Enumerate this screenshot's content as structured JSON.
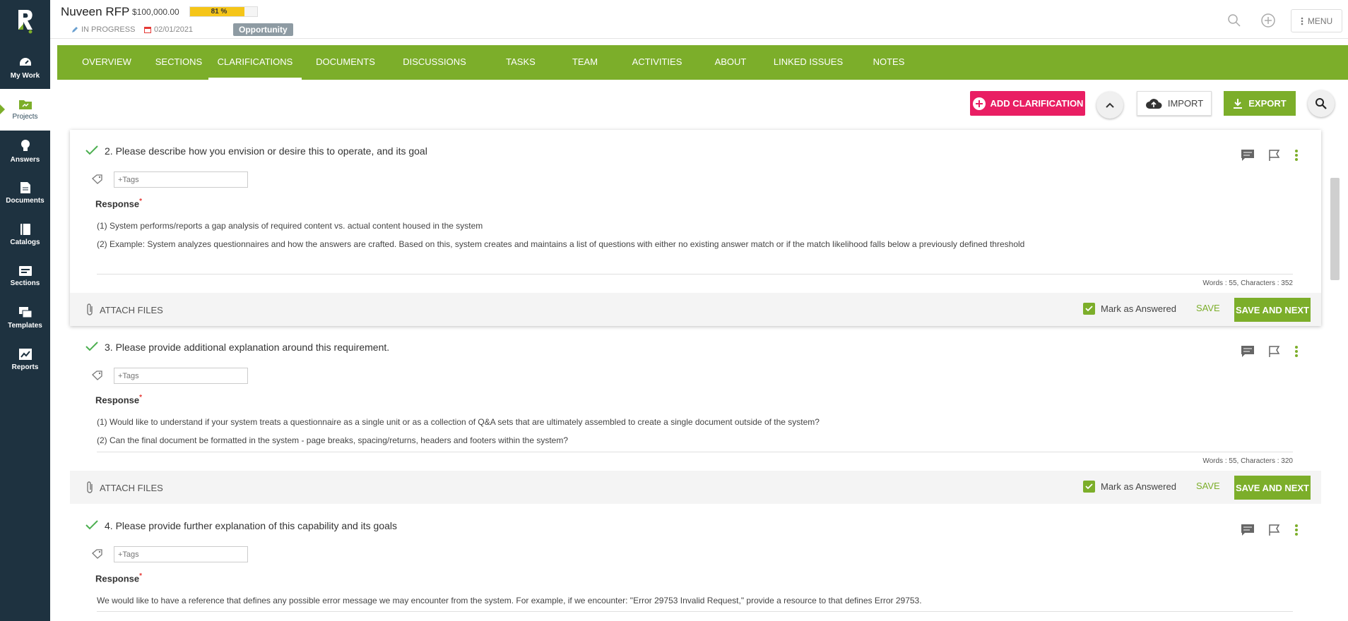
{
  "sidebar": {
    "items": [
      {
        "label": "My Work",
        "icon": "dashboard-icon"
      },
      {
        "label": "Projects",
        "icon": "folder-icon"
      },
      {
        "label": "Answers",
        "icon": "lightbulb-icon"
      },
      {
        "label": "Documents",
        "icon": "documents-icon"
      },
      {
        "label": "Catalogs",
        "icon": "book-icon"
      },
      {
        "label": "Sections",
        "icon": "sections-icon"
      },
      {
        "label": "Templates",
        "icon": "templates-icon"
      },
      {
        "label": "Reports",
        "icon": "reports-icon"
      }
    ]
  },
  "header": {
    "title": "Nuveen RFP",
    "amount": "$100,000.00",
    "progress_label": "81 %",
    "progress_value": 0.81,
    "status": "IN PROGRESS",
    "date": "02/01/2021",
    "badge": "Opportunity",
    "menu_label": "MENU"
  },
  "tabs": [
    "OVERVIEW",
    "SECTIONS",
    "CLARIFICATIONS",
    "DOCUMENTS",
    "DISCUSSIONS",
    "TASKS",
    "TEAM",
    "ACTIVITIES",
    "ABOUT",
    "LINKED ISSUES",
    "NOTES"
  ],
  "active_tab": "CLARIFICATIONS",
  "toolbar": {
    "add_label": "ADD CLARIFICATION",
    "import_label": "IMPORT",
    "export_label": "EXPORT"
  },
  "common": {
    "tags_placeholder": "+Tags",
    "response_label": "Response",
    "attach_label": "ATTACH FILES",
    "mark_label": "Mark as Answered",
    "save_label": "SAVE",
    "save_next_label": "SAVE AND NEXT"
  },
  "questions": [
    {
      "title": "2. Please describe how you envision or desire this to operate, and its goal",
      "lines": [
        "(1) System performs/reports a gap analysis of required content  vs. actual content housed in the system",
        "(2)  Example: System analyzes questionnaires and how the answers are crafted. Based on this, system creates and maintains a list of questions with either no existing answer match or if the match likelihood falls below a previously defined threshold"
      ],
      "counts": "Words : 55, Characters : 352"
    },
    {
      "title": "3. Please provide additional explanation around this requirement.",
      "lines": [
        "(1) Would like to understand if your system treats a questionnaire as a single unit or as a collection of Q&A sets that are ultimately assembled to create a single document outside of the system?",
        "(2) Can the final document be formatted in the system - page breaks, spacing/returns, headers and footers within the system?"
      ],
      "counts": "Words : 55, Characters : 320"
    },
    {
      "title": "4. Please provide further explanation of this capability and its goals",
      "lines": [
        "We would like to have a reference that defines any possible error message we may encounter from the system.  For example, if we encounter: \"Error 29753 Invalid Request,\" provide a resource to that defines Error 29753."
      ]
    }
  ],
  "colors": {
    "sidebar_bg": "#1e3240",
    "accent_green": "#7cae2a",
    "add_pink": "#e91e63",
    "progress_yellow": "#f5c518"
  }
}
